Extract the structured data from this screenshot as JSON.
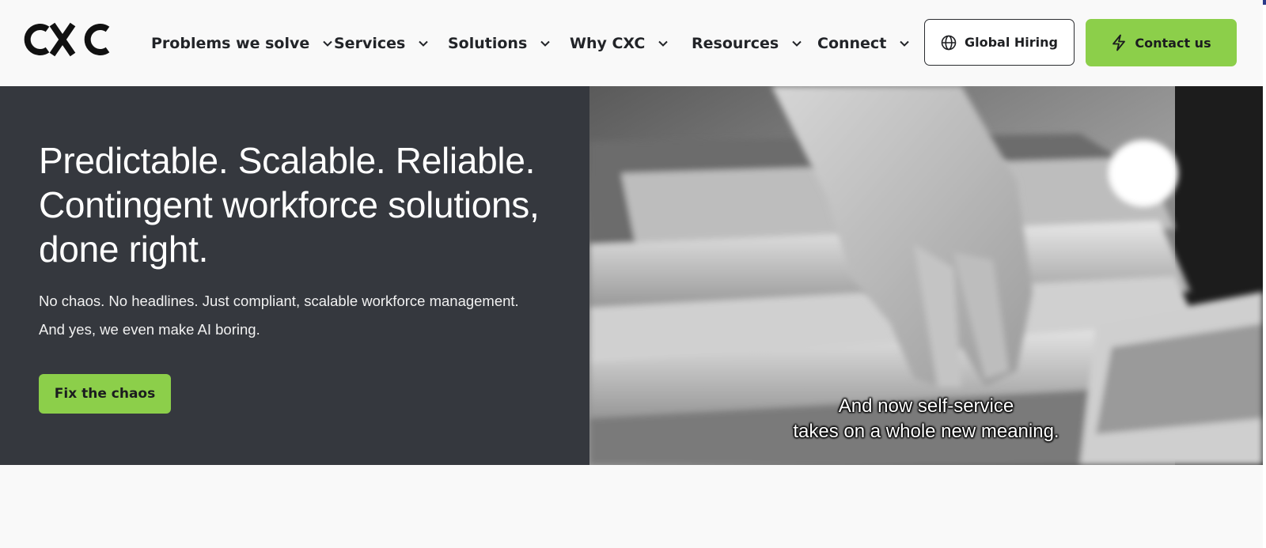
{
  "brand": {
    "logo_text": "CXC",
    "accent_color": "#8ccf4a",
    "dark_color": "#35383e"
  },
  "nav": {
    "items": [
      {
        "label": "Problems we solve",
        "icon": "chevron-down-icon"
      },
      {
        "label": "Services",
        "icon": "chevron-down-icon"
      },
      {
        "label": "Solutions",
        "icon": "chevron-down-icon"
      },
      {
        "label": "Why CXC",
        "icon": "chevron-down-icon"
      },
      {
        "label": "Resources",
        "icon": "chevron-down-icon"
      },
      {
        "label": "Connect",
        "icon": "chevron-down-icon"
      }
    ],
    "global_hiring": {
      "label": "Global Hiring",
      "icon": "globe-icon"
    },
    "contact": {
      "label": "Contact us",
      "icon": "lightning-icon"
    }
  },
  "hero": {
    "title_lines": [
      "Predictable. Scalable. Reliable.",
      "Contingent workforce solutions,",
      "done right."
    ],
    "subtitle_lines": [
      "No chaos. No headlines. Just compliant, scalable workforce management.",
      "And yes, we even make AI boring."
    ],
    "cta_label": "Fix the chaos"
  },
  "video": {
    "caption_lines": [
      "And now self-service",
      "takes on a whole new meaning."
    ]
  }
}
